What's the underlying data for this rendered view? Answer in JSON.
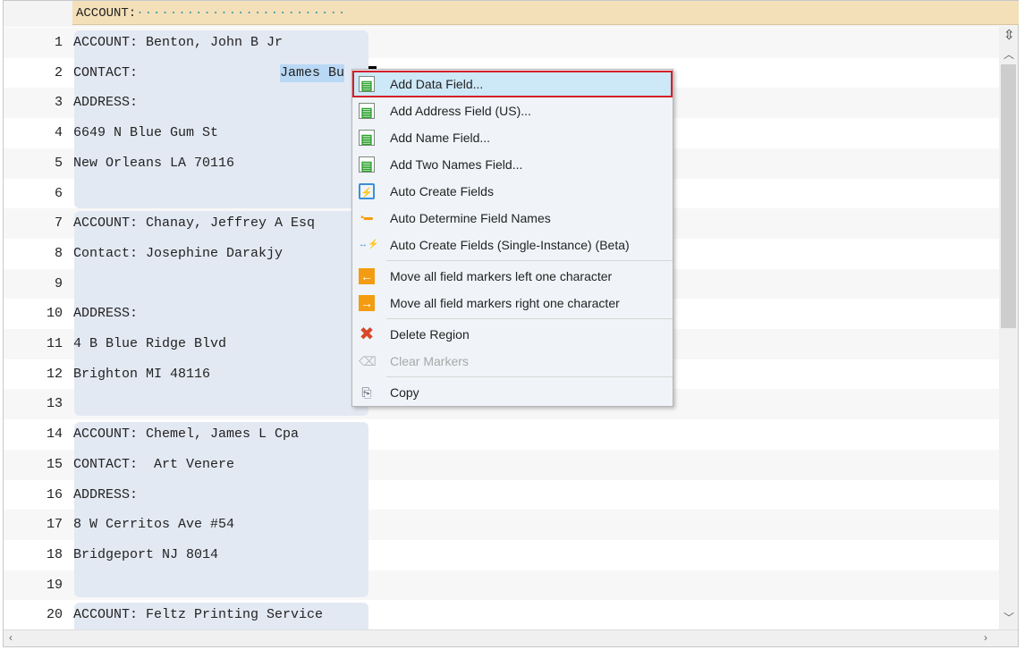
{
  "header": {
    "label": "ACCOUNT:",
    "dots": "·························"
  },
  "lines": [
    {
      "n": "1",
      "t": "ACCOUNT: Benton, John B Jr"
    },
    {
      "n": "2",
      "t": "CONTACT:",
      "sel": "James Bu"
    },
    {
      "n": "3",
      "t": "ADDRESS:"
    },
    {
      "n": "4",
      "t": "6649 N Blue Gum St"
    },
    {
      "n": "5",
      "t": "New Orleans LA 70116"
    },
    {
      "n": "6",
      "t": ""
    },
    {
      "n": "7",
      "t": "ACCOUNT: Chanay, Jeffrey A Esq"
    },
    {
      "n": "8",
      "t": "Contact: Josephine Darakjy"
    },
    {
      "n": "9",
      "t": ""
    },
    {
      "n": "10",
      "t": "ADDRESS:"
    },
    {
      "n": "11",
      "t": "4 B Blue Ridge Blvd"
    },
    {
      "n": "12",
      "t": "Brighton MI 48116"
    },
    {
      "n": "13",
      "t": ""
    },
    {
      "n": "14",
      "t": "ACCOUNT: Chemel, James L Cpa"
    },
    {
      "n": "15",
      "t": "CONTACT:  Art Venere"
    },
    {
      "n": "16",
      "t": "ADDRESS:"
    },
    {
      "n": "17",
      "t": "8 W Cerritos Ave #54"
    },
    {
      "n": "18",
      "t": "Bridgeport NJ 8014"
    },
    {
      "n": "19",
      "t": ""
    },
    {
      "n": "20",
      "t": "ACCOUNT: Feltz Printing Service"
    }
  ],
  "menu": {
    "items": [
      {
        "label": "Add Data Field...",
        "icon": "add-field-icon"
      },
      {
        "label": "Add Address Field (US)...",
        "icon": "add-field-icon"
      },
      {
        "label": "Add Name Field...",
        "icon": "add-field-icon"
      },
      {
        "label": "Add Two Names Field...",
        "icon": "add-field-icon"
      },
      {
        "label": "Auto Create Fields",
        "icon": "auto-create-icon"
      },
      {
        "label": "Auto Determine Field Names",
        "icon": "auto-determine-icon"
      },
      {
        "label": "Auto Create Fields (Single-Instance) (Beta)",
        "icon": "auto-create-single-icon"
      },
      {
        "label": "Move all field markers left one character",
        "icon": "move-left-icon"
      },
      {
        "label": "Move all field markers right one character",
        "icon": "move-right-icon"
      },
      {
        "label": "Delete Region",
        "icon": "delete-icon"
      },
      {
        "label": "Clear Markers",
        "icon": "eraser-icon"
      },
      {
        "label": "Copy",
        "icon": "copy-icon"
      }
    ]
  },
  "colors": {
    "highlight_border": "#d3202a",
    "region": "#e3e9f3",
    "header": "#f3dfb8"
  }
}
